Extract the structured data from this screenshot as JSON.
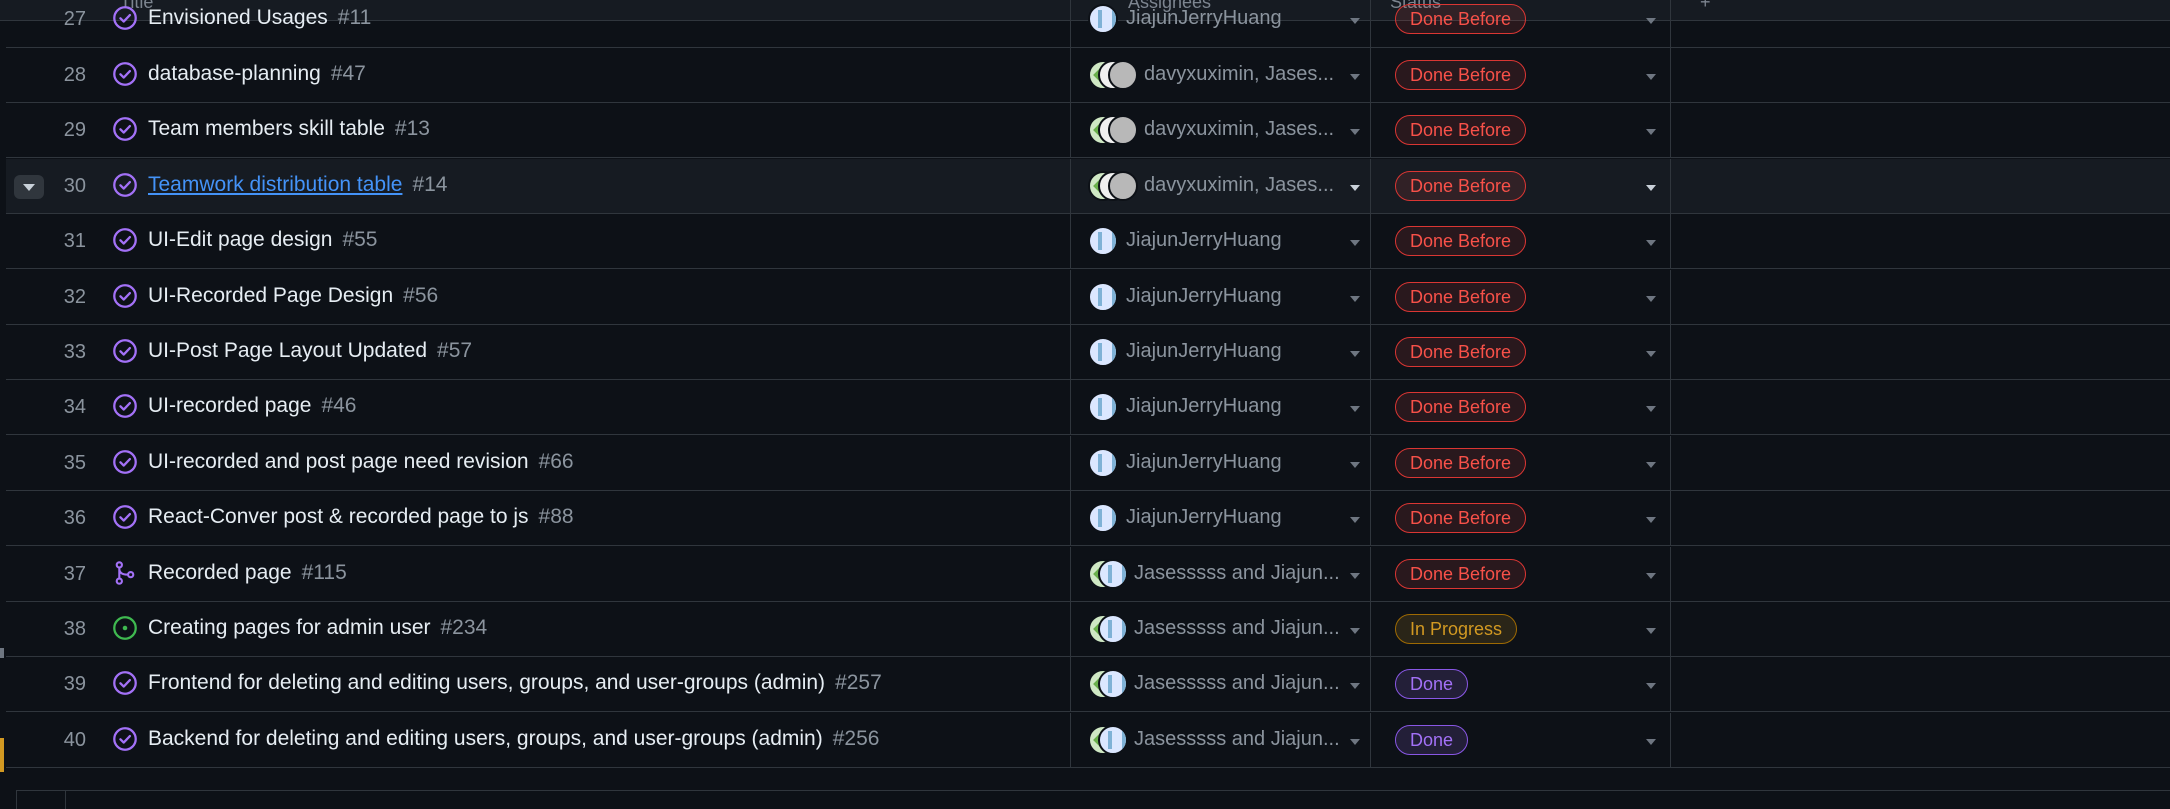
{
  "header": {
    "title_col": "Title",
    "assignees_col": "Assignees",
    "status_col": "Status",
    "add_col": "+"
  },
  "rows": [
    {
      "num": "27",
      "title": "Envisioned Usages",
      "issue": "#11",
      "icon": "done-circle-icon",
      "assignee_text": "JiajunJerryHuang",
      "avatars": [
        "h"
      ],
      "status": "Done Before"
    },
    {
      "num": "28",
      "title": "database-planning",
      "issue": "#47",
      "icon": "done-circle-icon",
      "assignee_text": "davyxuximin, Jases...",
      "avatars": [
        "g",
        "w",
        "d"
      ],
      "status": "Done Before"
    },
    {
      "num": "29",
      "title": "Team members skill table",
      "issue": "#13",
      "icon": "done-circle-icon",
      "assignee_text": "davyxuximin, Jases...",
      "avatars": [
        "g",
        "w",
        "d"
      ],
      "status": "Done Before"
    },
    {
      "num": "30",
      "title": "Teamwork distribution table",
      "issue": "#14",
      "icon": "done-circle-icon",
      "assignee_text": "davyxuximin, Jases...",
      "avatars": [
        "g",
        "w",
        "d"
      ],
      "status": "Done Before",
      "highlighted": true
    },
    {
      "num": "31",
      "title": "UI-Edit page design",
      "issue": "#55",
      "icon": "done-circle-icon",
      "assignee_text": "JiajunJerryHuang",
      "avatars": [
        "h"
      ],
      "status": "Done Before"
    },
    {
      "num": "32",
      "title": "UI-Recorded Page Design",
      "issue": "#56",
      "icon": "done-circle-icon",
      "assignee_text": "JiajunJerryHuang",
      "avatars": [
        "h"
      ],
      "status": "Done Before"
    },
    {
      "num": "33",
      "title": "UI-Post Page Layout Updated",
      "issue": "#57",
      "icon": "done-circle-icon",
      "assignee_text": "JiajunJerryHuang",
      "avatars": [
        "h"
      ],
      "status": "Done Before"
    },
    {
      "num": "34",
      "title": "UI-recorded page",
      "issue": "#46",
      "icon": "done-circle-icon",
      "assignee_text": "JiajunJerryHuang",
      "avatars": [
        "h"
      ],
      "status": "Done Before"
    },
    {
      "num": "35",
      "title": "UI-recorded and post page need revision",
      "issue": "#66",
      "icon": "done-circle-icon",
      "assignee_text": "JiajunJerryHuang",
      "avatars": [
        "h"
      ],
      "status": "Done Before"
    },
    {
      "num": "36",
      "title": "React-Conver post & recorded page to js",
      "issue": "#88",
      "icon": "done-circle-icon",
      "assignee_text": "JiajunJerryHuang",
      "avatars": [
        "h"
      ],
      "status": "Done Before"
    },
    {
      "num": "37",
      "title": "Recorded page",
      "issue": "#115",
      "icon": "merged-pr-icon",
      "assignee_text": "Jasesssss and Jiajun...",
      "avatars": [
        "g",
        "h"
      ],
      "status": "Done Before"
    },
    {
      "num": "38",
      "title": "Creating pages for admin user",
      "issue": "#234",
      "icon": "open-issue-icon",
      "assignee_text": "Jasesssss and Jiajun...",
      "avatars": [
        "g",
        "h"
      ],
      "status": "In Progress"
    },
    {
      "num": "39",
      "title": "Frontend for deleting and editing users, groups, and user-groups (admin)",
      "issue": "#257",
      "icon": "done-circle-icon",
      "assignee_text": "Jasesssss and Jiajun...",
      "avatars": [
        "g",
        "h"
      ],
      "status": "Done"
    },
    {
      "num": "40",
      "title": "Backend for deleting and editing users, groups, and user-groups (admin)",
      "issue": "#256",
      "icon": "done-circle-icon",
      "assignee_text": "Jasesssss and Jiajun...",
      "avatars": [
        "g",
        "h"
      ],
      "status": "Done"
    }
  ],
  "colors": {
    "done_before": "#f85149",
    "in_progress": "#d29922",
    "done": "#a371f7",
    "open": "#3fb950",
    "link": "#4493f8"
  }
}
